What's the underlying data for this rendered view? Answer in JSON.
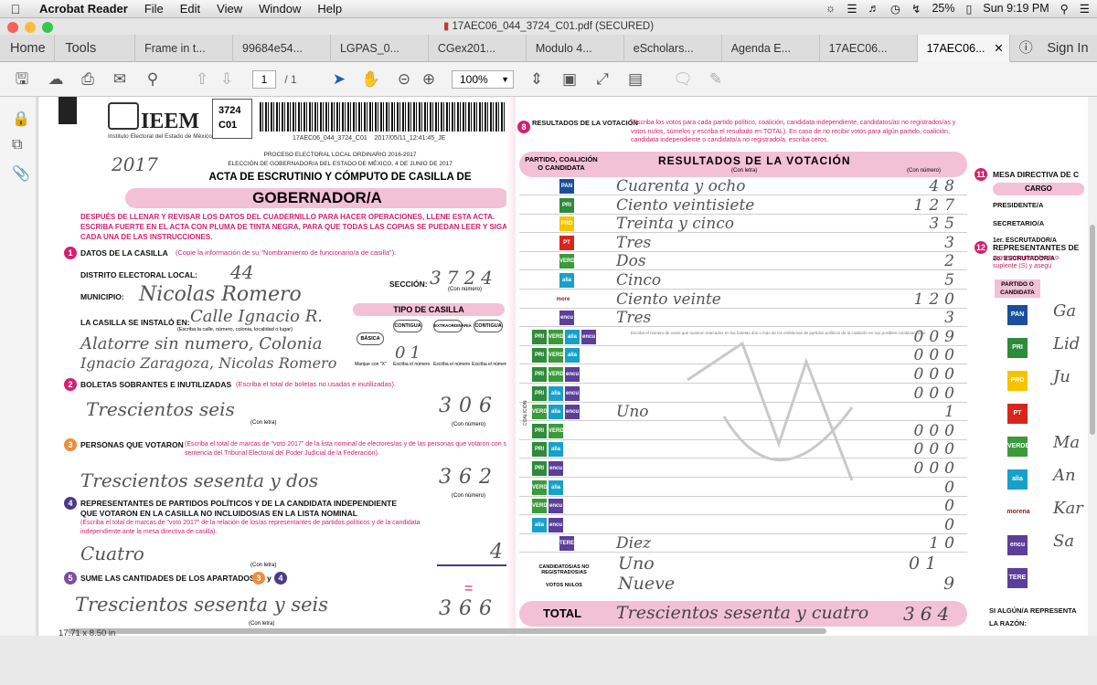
{
  "menubar": {
    "app": "Acrobat Reader",
    "items": [
      "File",
      "Edit",
      "View",
      "Window",
      "Help"
    ],
    "battery": "25%",
    "clock": "Sun 9:19 PM"
  },
  "window": {
    "title": "17AEC06_044_3724_C01.pdf (SECURED)"
  },
  "tabs": {
    "home": "Home",
    "tools": "Tools",
    "docs": [
      "Frame in t...",
      "99684e54...",
      "LGPAS_0...",
      "CGex201...",
      "Modulo 4...",
      "eScholars...",
      "Agenda E...",
      "17AEC06...",
      "17AEC06..."
    ],
    "sign_in": "Sign In"
  },
  "toolbar": {
    "page_current": "1",
    "page_total": "/ 1",
    "zoom": "100%"
  },
  "status": {
    "page_size": "17.71 x 8.50 in"
  },
  "colors": {
    "accent": "#d4206e",
    "pink_fill": "#f3c1d6"
  },
  "form": {
    "code_box": [
      "3724",
      "C01"
    ],
    "barcode_text": "17AEC06_044_3724_C01    2017/05/11_12:41:45_JE",
    "year_hand": "2017",
    "org": "IEEM",
    "org_full": "Instituto Electoral del Estado de México",
    "proc_line1": "PROCESO ELECTORAL LOCAL ORDINARIO 2016-2017",
    "proc_line2": "ELECCIÓN DE GOBERNADOR/A DEL ESTADO DE MÉXICO, 4 DE JUNIO DE 2017",
    "title": "ACTA DE ESCRUTINIO Y CÓMPUTO DE CASILLA DE",
    "subtitle": "GOBERNADOR/A",
    "instructions": "DESPUÉS DE LLENAR Y REVISAR LOS DATOS DEL CUADERNILLO PARA HACER OPERACIONES, LLENE ESTA ACTA. ESCRIBA FUERTE EN EL ACTA CON PLUMA DE TINTA NEGRA, PARA QUE TODAS LAS COPIAS SE PUEDAN LEER Y SIGA CADA UNA DE LAS INSTRUCCIONES.",
    "s1_title": "DATOS DE LA CASILLA",
    "s1_hint": "(Copie la información de su \"Nombramiento de funcionario/a de casilla\").",
    "distrito_lbl": "DISTRITO ELECTORAL LOCAL:",
    "distrito_val": "44",
    "seccion_lbl": "SECCIÓN:",
    "seccion_val": "3724",
    "con_numero": "(Con número)",
    "municipio_lbl": "MUNICIPIO:",
    "municipio_val": "Nicolas Romero",
    "tipo_title": "TIPO DE CASILLA",
    "tipo_opts": [
      "BÁSICA",
      "CONTIGUA",
      "EXTRAORDINARIA",
      "CONTIGUA"
    ],
    "tipo_val": "01",
    "tipo_hints": [
      "Marque con \"X\"",
      "Escriba el número",
      "Escriba el número",
      "Escriba el número"
    ],
    "instalo_lbl": "LA CASILLA SE INSTALÓ EN:",
    "instalo_hint": "(Escriba la calle, número, colonia, localidad o lugar)",
    "instalo_val": [
      "Calle Ignacio R.",
      "Alatorre sin numero, Colonia",
      "Ignacio Zaragoza, Nicolas Romero"
    ],
    "s2_title": "BOLETAS SOBRANTES E INUTILIZADAS",
    "s2_hint": "(Escriba el total de boletas no usadas e inutilizadas).",
    "s2_val_text": "Trescientos seis",
    "s2_val_num": "306",
    "con_letra": "(Con letra)",
    "s3_title": "PERSONAS QUE VOTARON",
    "s3_hint": "(Escriba el total de marcas de \"votó 2017\" de la lista nominal de electores/as y de las personas que votaron con su sentencia del Tribunal Electoral del Poder Judicial de la Federación).",
    "s3_val_text": "Trescientos sesenta y dos",
    "s3_val_num": "362",
    "s4_title": "REPRESENTANTES DE PARTIDOS POLÍTICOS Y DE LA CANDIDATA INDEPENDIENTE QUE VOTARON EN LA CASILLA NO INCLUIDOS/AS EN LA LISTA NOMINAL",
    "s4_hint": "(Escriba el total de marcas de \"votó 2017\" de la relación de los/as representantes de partidos políticos y de la candidata independiente ante la mesa directiva de casilla).",
    "s4_val_text": "Cuatro",
    "s4_val_num": "4",
    "s5_title": "SUME LAS CANTIDADES DE LOS APARTADOS",
    "s5_and": "y",
    "s5_val_text": "Trescientos sesenta y seis",
    "s5_val_num": "366",
    "s8_title": "RESULTADOS DE LA VOTACIÓN",
    "s8_hint": "(Escriba los votos para cada partido político, coalición, candidata independiente, candidatos/as no registrados/as y votos nulos, súmelos y escriba el resultado en TOTAL). En caso de no recibir votos para algún partido, coalición, candidata independiente o candidato/a no registrado/a, escriba ceros.",
    "col_party": "PARTIDO, COALICIÓN O CANDIDATA",
    "col_results": "RESULTADOS DE LA VOTACIÓN",
    "col_letra": "(Con letra)",
    "col_numero": "(Con número)",
    "coalition_hint": "Escriba el número de votos que tuvieron marcados en las boletas dos o más de los emblemas de partidos políticos de la coalición en sus posibles combinaciones",
    "coalition_label": "COALICIÓN",
    "rows": [
      {
        "logo": "PAN",
        "word": "Cuarenta y ocho",
        "num": "48"
      },
      {
        "logo": "PRI",
        "word": "Ciento veintisiete",
        "num": "127"
      },
      {
        "logo": "PRD",
        "word": "Treinta y cinco",
        "num": "35"
      },
      {
        "logo": "PT",
        "word": "Tres",
        "num": "3"
      },
      {
        "logo": "VERDE",
        "word": "Dos",
        "num": "2"
      },
      {
        "logo": "alianza",
        "word": "Cinco",
        "num": "5"
      },
      {
        "logo": "morena",
        "word": "Ciento veinte",
        "num": "120"
      },
      {
        "logo": "encuentro",
        "word": "Tres",
        "num": "3"
      },
      {
        "logo": "PRI+VERDE+alianza+encuentro",
        "word": "",
        "num": "009"
      },
      {
        "logo": "PRI+VERDE+alianza",
        "word": "",
        "num": "000"
      },
      {
        "logo": "PRI+VERDE+encuentro",
        "word": "",
        "num": "000"
      },
      {
        "logo": "PRI+alianza+encuentro",
        "word": "",
        "num": "000"
      },
      {
        "logo": "VERDE+alianza+encuentro",
        "word": "Uno",
        "num": "1"
      },
      {
        "logo": "PRI+VERDE",
        "word": "",
        "num": "000"
      },
      {
        "logo": "PRI+alianza",
        "word": "",
        "num": "000"
      },
      {
        "logo": "PRI+encuentro",
        "word": "",
        "num": "000"
      },
      {
        "logo": "VERDE+alianza",
        "word": "",
        "num": "0"
      },
      {
        "logo": "VERDE+encuentro",
        "word": "",
        "num": "0"
      },
      {
        "logo": "alianza+encuentro",
        "word": "",
        "num": "0"
      },
      {
        "logo": "TERESA CASTELL",
        "word": "Diez",
        "num": "10"
      }
    ],
    "no_reg_lbl": "CANDIDATOS/AS NO REGISTRADOS/AS",
    "no_reg_word": "Uno",
    "no_reg_num": "01",
    "nulos_lbl": "VOTOS NULOS",
    "nulos_word": "Nueve",
    "nulos_num": "9",
    "total_lbl": "TOTAL",
    "total_word": "Trescientos sesenta y cuatro",
    "total_num": "364",
    "s11_title": "MESA DIRECTIVA DE C",
    "cargo_lbl": "CARGO",
    "cargos": [
      "PRESIDENTE/A",
      "SECRETARIO/A",
      "1er. ESCRUTADOR/A",
      "2o. ESCRUTADOR/A"
    ],
    "s12_title": "REPRESENTANTES DE",
    "s12_hint": "representantes de pa o suplente (S) y asegu",
    "s12_col": "PARTIDO O CANDIDATA",
    "rep_logos": [
      "PAN",
      "PRI",
      "PRD",
      "PT",
      "VERDE",
      "alianza",
      "morena",
      "encuentro",
      "TERESA CASTELL"
    ],
    "rep_names": [
      "Ga",
      "Lid",
      "Ju",
      "",
      "Ma",
      "An",
      "Kar",
      "Sa",
      ""
    ],
    "bottom_right": "SI ALGÚN/A REPRESENTA",
    "bottom_right2": "LA RAZÓN:"
  }
}
